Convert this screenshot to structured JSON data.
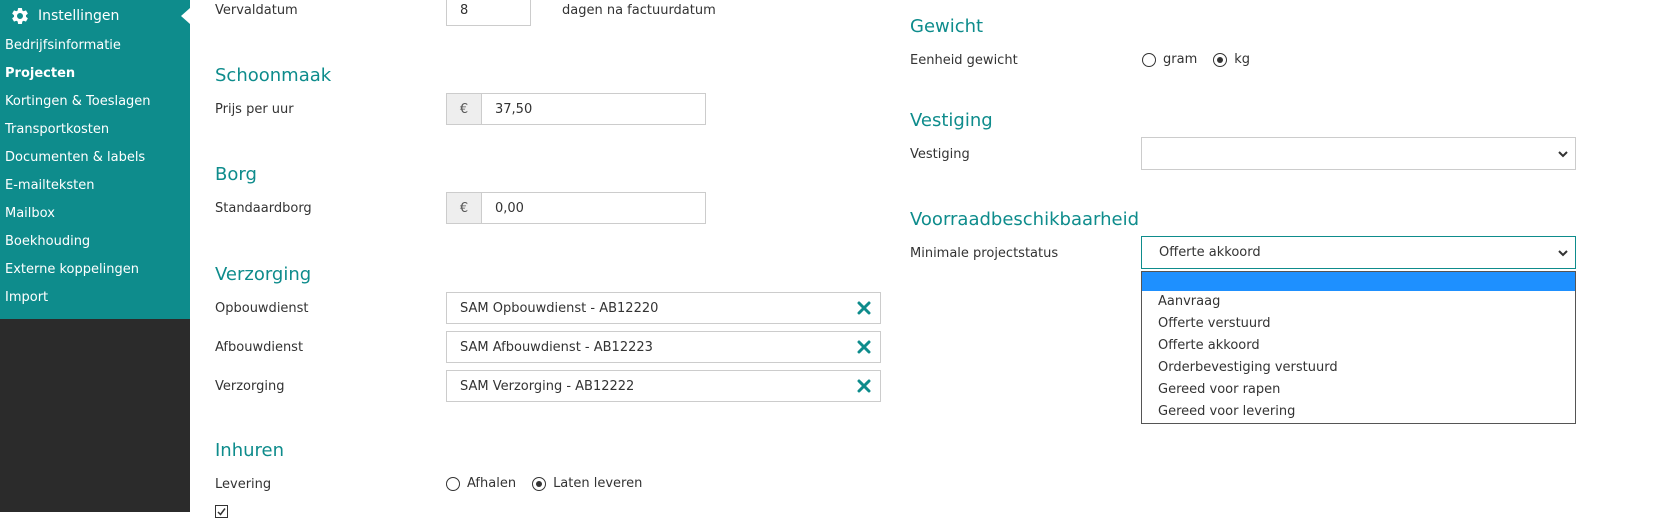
{
  "sidebar": {
    "title": "Instellingen",
    "items": [
      {
        "label": "Bedrijfsinformatie",
        "active": false
      },
      {
        "label": "Projecten",
        "active": true
      },
      {
        "label": "Kortingen & Toeslagen",
        "active": false
      },
      {
        "label": "Transportkosten",
        "active": false
      },
      {
        "label": "Documenten & labels",
        "active": false
      },
      {
        "label": "E-mailteksten",
        "active": false
      },
      {
        "label": "Mailbox",
        "active": false
      },
      {
        "label": "Boekhouding",
        "active": false
      },
      {
        "label": "Externe koppelingen",
        "active": false
      },
      {
        "label": "Import",
        "active": false
      }
    ]
  },
  "colors": {
    "accent": "#0e8c8c",
    "sidebar_bg": "#2b2b2b",
    "highlight": "#1e90ff"
  },
  "left": {
    "vervaldatum": {
      "label": "Vervaldatum",
      "value": "8",
      "suffix": "dagen na factuurdatum"
    },
    "schoonmaak": {
      "title": "Schoonmaak",
      "label": "Prijs per uur",
      "currency": "€",
      "value": "37,50"
    },
    "borg": {
      "title": "Borg",
      "label": "Standaardborg",
      "currency": "€",
      "value": "0,00"
    },
    "verzorging": {
      "title": "Verzorging",
      "rows": [
        {
          "label": "Opbouwdienst",
          "value": "SAM Opbouwdienst - AB12220"
        },
        {
          "label": "Afbouwdienst",
          "value": "SAM Afbouwdienst - AB12223"
        },
        {
          "label": "Verzorging",
          "value": "SAM Verzorging - AB12222"
        }
      ]
    },
    "inhuren": {
      "title": "Inhuren",
      "label": "Levering",
      "option1": "Afhalen",
      "option2": "Laten leveren",
      "selected": "Laten leveren"
    }
  },
  "right": {
    "gewicht": {
      "title": "Gewicht",
      "label": "Eenheid gewicht",
      "option1": "gram",
      "option2": "kg",
      "selected": "kg"
    },
    "vestiging": {
      "title": "Vestiging",
      "label": "Vestiging",
      "value": ""
    },
    "voorraad": {
      "title": "Voorraadbeschikbaarheid",
      "label": "Minimale projectstatus",
      "value": "Offerte akkoord",
      "options": [
        "",
        "Aanvraag",
        "Offerte verstuurd",
        "Offerte akkoord",
        "Orderbevestiging verstuurd",
        "Gereed voor rapen",
        "Gereed voor levering"
      ]
    }
  }
}
